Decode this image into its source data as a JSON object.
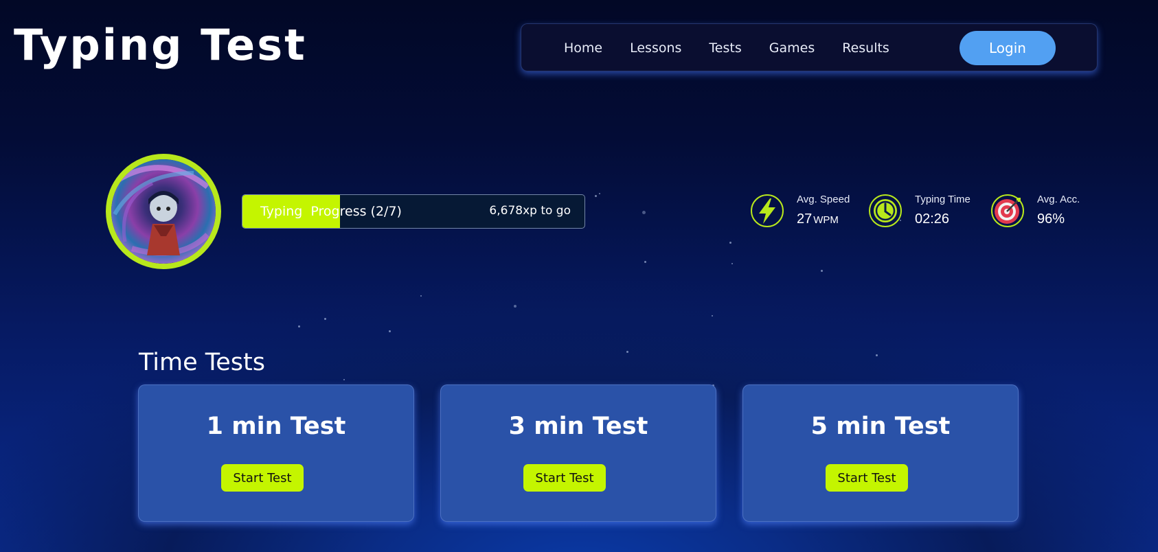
{
  "app": {
    "logo_text": "Typing Test"
  },
  "nav": {
    "links": [
      "Home",
      "Lessons",
      "Tests",
      "Games",
      "Results"
    ],
    "login_label": "Login",
    "colors": {
      "background": "#0a0e30",
      "login": "#52a0f2"
    }
  },
  "profile": {
    "avatar": "user-avatar",
    "progress": {
      "label": "Typing  Progress (2/7)",
      "xp_to_go": "6,678xp to go",
      "fraction": 0.286,
      "fill_color": "#c4f500"
    }
  },
  "stats": [
    {
      "icon": "lightning-icon",
      "label": "Avg. Speed",
      "value": "27",
      "unit": "WPM"
    },
    {
      "icon": "clock-icon",
      "label": "Typing Time",
      "value": "02:26",
      "unit": ""
    },
    {
      "icon": "target-icon",
      "label": "Avg. Acc.",
      "value": "96%",
      "unit": ""
    }
  ],
  "time_tests": {
    "title": "Time Tests",
    "cards": [
      {
        "title": "1 min Test",
        "button": "Start Test"
      },
      {
        "title": "3 min Test",
        "button": "Start Test"
      },
      {
        "title": "5 min Test",
        "button": "Start Test"
      }
    ]
  },
  "colors": {
    "accent": "#c4f500",
    "card": "#2a52a8"
  }
}
